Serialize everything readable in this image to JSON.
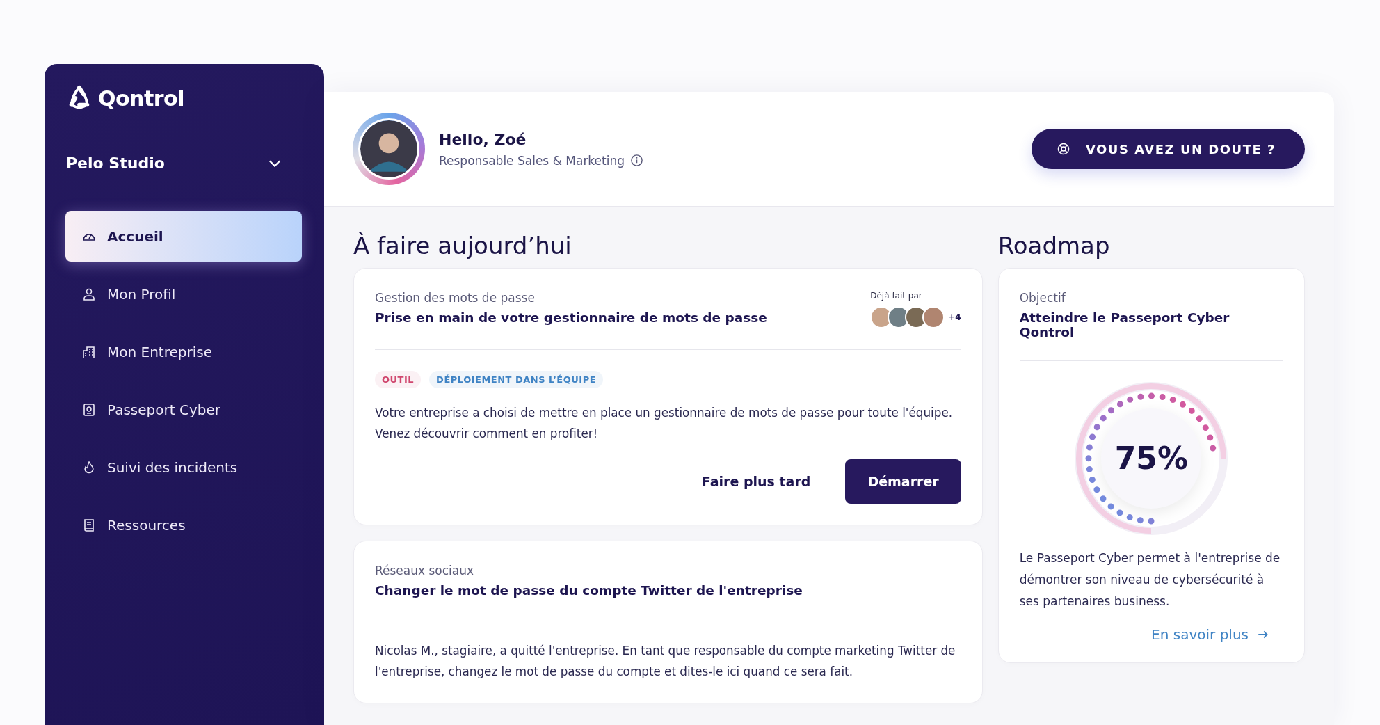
{
  "sidebar": {
    "brand": "Qontrol",
    "organization": "Pelo Studio",
    "items": [
      {
        "label": "Accueil",
        "selected": true
      },
      {
        "label": "Mon Profil",
        "selected": false
      },
      {
        "label": "Mon Entreprise",
        "selected": false
      },
      {
        "label": "Passeport Cyber",
        "selected": false
      },
      {
        "label": "Suivi des incidents",
        "selected": false
      },
      {
        "label": "Ressources",
        "selected": false
      }
    ]
  },
  "header": {
    "greeting": "Hello, Zoé",
    "role": "Responsable Sales & Marketing",
    "help_button": "VOUS AVEZ UN DOUTE ?"
  },
  "todo": {
    "title": "À faire aujourd’hui",
    "tasks": [
      {
        "category": "Gestion des mots de passe",
        "title": "Prise en main de votre gestionnaire de mots de passe",
        "done_by_label": "Déjà fait par",
        "done_by_more": "+4",
        "tags": [
          {
            "label": "OUTIL",
            "color": "#d0476e"
          },
          {
            "label": "DÉPLOIEMENT DANS L’ÉQUIPE",
            "color": "#3f83c4"
          }
        ],
        "description": "Votre entreprise a choisi de mettre en place un gestionnaire de mots de passe pour toute l'équipe. Venez découvrir comment en profiter!",
        "actions": [
          "Faire plus tard",
          "Démarrer"
        ]
      },
      {
        "category": "Réseaux sociaux",
        "title": "Changer le mot de passe du compte Twitter de l'entreprise",
        "description": "Nicolas M., stagiaire, a quitté l'entreprise. En tant que responsable du compte marketing Twitter de l'entreprise, changez le mot de passe du compte et dites-le ici quand ce sera fait."
      }
    ]
  },
  "roadmap": {
    "title": "Roadmap",
    "label": "Objectif",
    "goal": "Atteindre le Passeport Cyber Qontrol",
    "level": 0.75,
    "reading": "75%",
    "description": "Le Passeport Cyber permet à l'entreprise de démontrer son niveau de cybersécurité à ses partenaires business.",
    "link": "En savoir plus"
  }
}
